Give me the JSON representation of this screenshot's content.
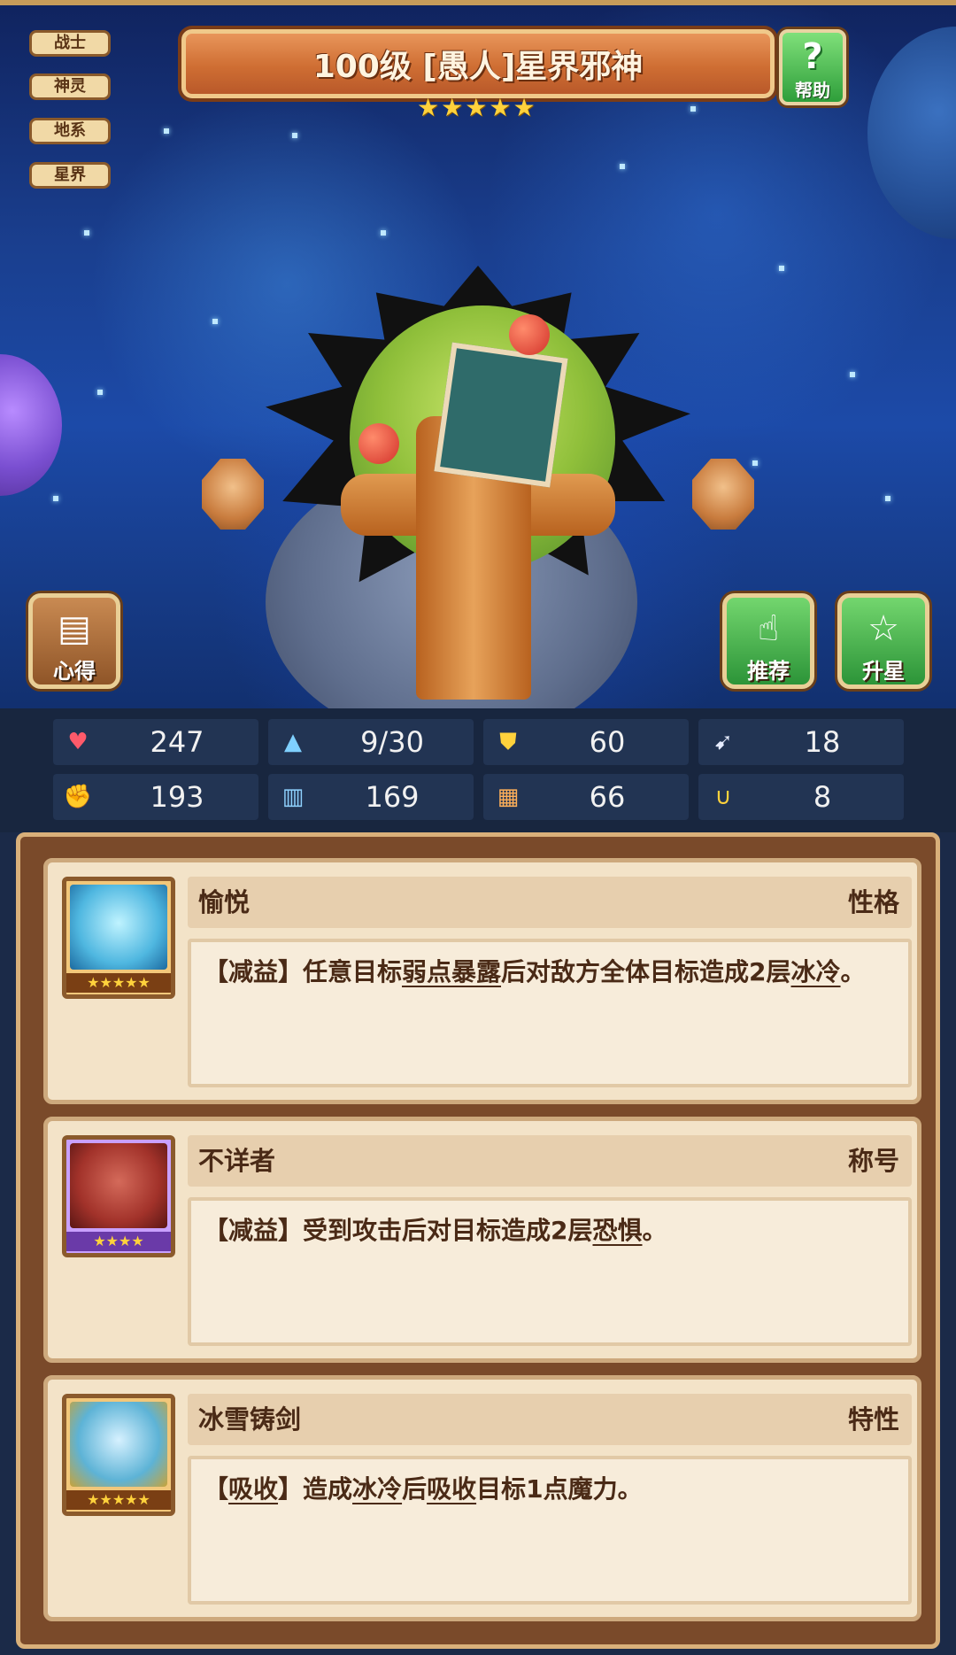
{
  "hero": {
    "title": "100级 [愚人]星界邪神",
    "stars": 5,
    "tags": [
      "战士",
      "神灵",
      "地系",
      "星界"
    ]
  },
  "buttons": {
    "help_label": "帮助",
    "help_icon": "question-icon",
    "notes_label": "心得",
    "recommend_label": "推荐",
    "star_up_label": "升星"
  },
  "stats": [
    {
      "icon": "heart-icon",
      "value": "247",
      "color": "#ff5a6a"
    },
    {
      "icon": "water-drop-icon",
      "value": "9/30",
      "color": "#7fd0ff"
    },
    {
      "icon": "shield-icon",
      "value": "60",
      "color": "#ffd23c"
    },
    {
      "icon": "wing-icon",
      "value": "18",
      "color": "#e6ecff"
    },
    {
      "icon": "fist-icon",
      "value": "193",
      "color": "#ff7e5a"
    },
    {
      "icon": "book-icon",
      "value": "169",
      "color": "#8fd2ff"
    },
    {
      "icon": "scroll-icon",
      "value": "66",
      "color": "#ffb05a"
    },
    {
      "icon": "horseshoe-icon",
      "value": "8",
      "color": "#ffd23c"
    }
  ],
  "traits": [
    {
      "name": "愉悦",
      "type": "性格",
      "stars": 5,
      "desc_prefix": "【减益】任意目标",
      "desc_kw1": "弱点暴露",
      "desc_mid": "后对敌方全体目标造成2层",
      "desc_kw2": "冰冷",
      "desc_suffix": "。"
    },
    {
      "name": "不详者",
      "type": "称号",
      "stars": 4,
      "desc_prefix": "【减益】受到攻击后对目标造成2层",
      "desc_kw1": "恐惧",
      "desc_suffix": "。"
    },
    {
      "name": "冰雪铸剑",
      "type": "特性",
      "stars": 5,
      "desc_p1": "【",
      "desc_kw1": "吸收",
      "desc_p2": "】造成",
      "desc_kw2": "冰冷",
      "desc_p3": "后",
      "desc_kw3": "吸收",
      "desc_p4": "目标1点魔力。"
    }
  ],
  "colors": {
    "banner": "#cf6e33",
    "panel": "#7a4a2a",
    "card": "#f3e3c8",
    "star": "#ffd23c"
  }
}
